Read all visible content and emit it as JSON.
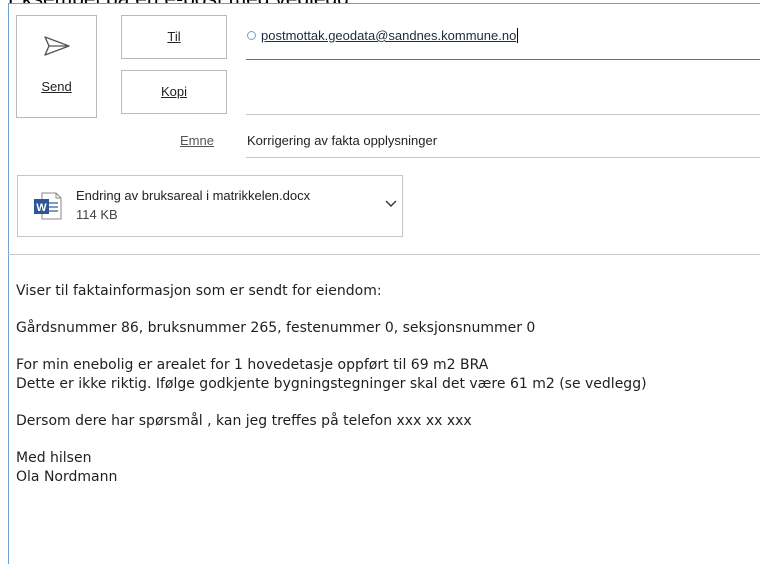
{
  "caption": "Eksempel på en e-post med vedlegg",
  "toolbar": {
    "send_label": "Send",
    "to_label": "Til",
    "cc_label": "Kopi",
    "subject_label": "Emne"
  },
  "message": {
    "to": "postmottak.geodata@sandnes.kommune.no",
    "subject": "Korrigering av fakta opplysninger"
  },
  "attachment": {
    "name": "Endring av bruksareal i matrikkelen.docx",
    "size": "114 KB",
    "icon": "word-document-icon"
  },
  "body": {
    "line1": "Viser til faktainformasjon som er sendt for eiendom:",
    "line2": "Gårdsnummer 86, bruksnummer 265, festenummer 0, seksjonsnummer 0",
    "line3": "For min enebolig er arealet for 1 hovedetasje oppført til 69 m2 BRA",
    "line4": "Dette er ikke riktig. Ifølge godkjente bygningstegninger skal det være 61 m2 (se vedlegg)",
    "line5": "Dersom dere har spørsmål , kan jeg treffes på telefon xxx xx xxx",
    "line6": "Med hilsen",
    "line7": "Ola Nordmann"
  },
  "colors": {
    "accent": "#3c76c2",
    "word_blue": "#2b579a"
  }
}
